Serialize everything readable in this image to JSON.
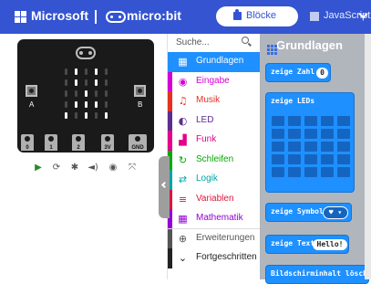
{
  "header": {
    "brand": "Microsoft",
    "product": "micro:bit",
    "tabs": [
      {
        "label": "Blöcke",
        "active": true
      },
      {
        "label": "JavaScript",
        "active": false
      }
    ],
    "colors": {
      "bar": "#3454d1",
      "text": "#ffffff"
    }
  },
  "simulator": {
    "leds_on": [
      [
        0,
        0
      ],
      [
        0,
        0
      ],
      [
        0,
        0
      ],
      [
        0,
        0
      ],
      [
        0,
        0
      ]
    ],
    "led_pattern": [
      [
        0,
        1,
        0,
        1,
        0
      ],
      [
        0,
        1,
        0,
        1,
        0
      ],
      [
        0,
        0,
        1,
        0,
        0
      ],
      [
        0,
        1,
        1,
        1,
        0
      ],
      [
        1,
        0,
        1,
        0,
        1
      ]
    ],
    "button_a": "A",
    "button_b": "B",
    "pins": [
      "0",
      "1",
      "2",
      "3V",
      "GND"
    ],
    "controls": [
      {
        "name": "play-icon",
        "glyph": "▶"
      },
      {
        "name": "restart-icon",
        "glyph": "⟳"
      },
      {
        "name": "debug-icon",
        "glyph": "✱"
      },
      {
        "name": "sound-icon",
        "glyph": "◄)"
      },
      {
        "name": "screenshot-icon",
        "glyph": "◉"
      },
      {
        "name": "fullscreen-icon",
        "glyph": "⤧"
      }
    ]
  },
  "toolbox": {
    "search_placeholder": "Suche...",
    "items": [
      {
        "label": "Grundlagen",
        "color": "#1e90ff",
        "icon": "grid-icon",
        "glyph": "▦",
        "active": true
      },
      {
        "label": "Eingabe",
        "color": "#d400d4",
        "icon": "input-icon",
        "glyph": "◉",
        "active": false
      },
      {
        "label": "Musik",
        "color": "#e63022",
        "icon": "headphones-icon",
        "glyph": "♫",
        "active": false
      },
      {
        "label": "LED",
        "color": "#5c2d91",
        "icon": "toggle-icon",
        "glyph": "◐",
        "active": false
      },
      {
        "label": "Funk",
        "color": "#e3008c",
        "icon": "signal-icon",
        "glyph": "▟",
        "active": false
      },
      {
        "label": "Schleifen",
        "color": "#00aa00",
        "icon": "loop-icon",
        "glyph": "↻",
        "active": false
      },
      {
        "label": "Logik",
        "color": "#00a4a6",
        "icon": "shuffle-icon",
        "glyph": "⇄",
        "active": false
      },
      {
        "label": "Variablen",
        "color": "#dc143c",
        "icon": "list-icon",
        "glyph": "≡",
        "active": false
      },
      {
        "label": "Mathematik",
        "color": "#9400d3",
        "icon": "calculator-icon",
        "glyph": "▦",
        "active": false
      },
      {
        "label": "Erweiterungen",
        "color": "#555555",
        "icon": "plus-circle-icon",
        "glyph": "⊕",
        "active": false
      },
      {
        "label": "Fortgeschritten",
        "color": "#222222",
        "icon": "chevron-down-icon",
        "glyph": "⌄",
        "active": false
      }
    ]
  },
  "flyout": {
    "heading": "Grundlagen",
    "blocks": {
      "show_number": {
        "label": "zeige Zahl",
        "value": "0"
      },
      "show_leds": {
        "label": "zeige LEDs"
      },
      "show_icon": {
        "label": "zeige Symbol"
      },
      "show_string": {
        "label": "zeige Text",
        "value": "Hello!"
      },
      "clear_screen": {
        "label": "Bildschirminhalt löschen"
      }
    },
    "block_color": "#1e90ff"
  }
}
